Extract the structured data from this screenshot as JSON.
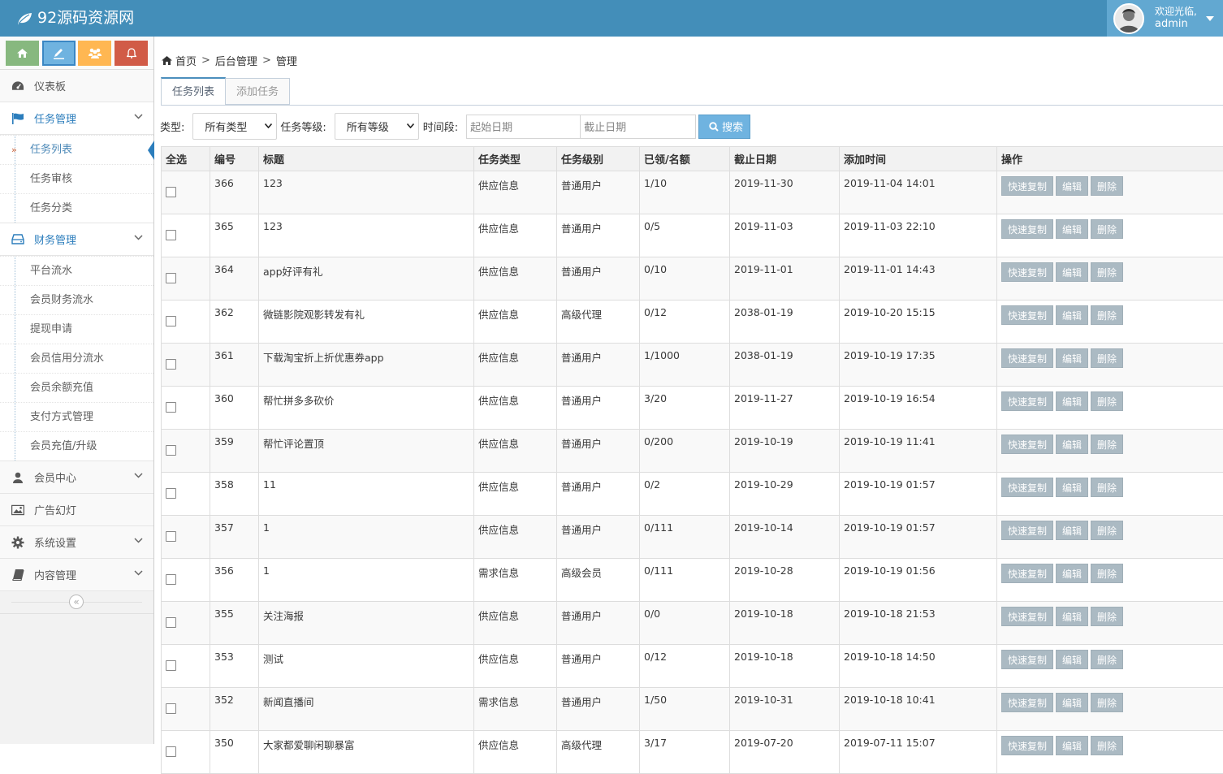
{
  "app": {
    "brand": "92源码资源网",
    "brand_icon": "leaf-icon"
  },
  "user": {
    "welcome": "欢迎光临,",
    "name": "admin"
  },
  "shortcuts": [
    {
      "name": "home-icon",
      "color": "#87b87f"
    },
    {
      "name": "pencil-icon",
      "color": "#6fb3e0"
    },
    {
      "name": "users-icon",
      "color": "#ffb752"
    },
    {
      "name": "bell-icon",
      "color": "#d15b47"
    }
  ],
  "sidebar": {
    "dashboard": "仪表板",
    "task_mgmt": "任务管理",
    "task_sub": [
      "任务列表",
      "任务审核",
      "任务分类"
    ],
    "finance_mgmt": "财务管理",
    "finance_sub": [
      "平台流水",
      "会员财务流水",
      "提现申请",
      "会员信用分流水",
      "会员余额充值",
      "支付方式管理",
      "会员充值/升级"
    ],
    "member_center": "会员中心",
    "ads": "广告幻灯",
    "settings": "系统设置",
    "content": "内容管理",
    "collapse_glyph": "«"
  },
  "breadcrumb": {
    "home": "首页",
    "sep": ">",
    "level2": "后台管理",
    "level3": "管理"
  },
  "tabs": {
    "list": "任务列表",
    "add": "添加任务"
  },
  "filter": {
    "type_label": "类型:",
    "type_value": "所有类型",
    "level_label": "任务等级:",
    "level_value": "所有等级",
    "time_label": "时间段:",
    "start_placeholder": "起始日期",
    "end_placeholder": "截止日期",
    "search_label": "搜索"
  },
  "table": {
    "headers": [
      "全选",
      "编号",
      "标题",
      "任务类型",
      "任务级别",
      "已领/名额",
      "截止日期",
      "添加时间",
      "操作"
    ],
    "actions": {
      "copy": "快速复制",
      "edit": "编辑",
      "delete": "删除"
    },
    "rows": [
      {
        "id": "366",
        "title": "123",
        "type": "供应信息",
        "level": "普通用户",
        "quota": "1/10",
        "deadline": "2019-11-30",
        "added": "2019-11-04 14:01"
      },
      {
        "id": "365",
        "title": "123",
        "type": "供应信息",
        "level": "普通用户",
        "quota": "0/5",
        "deadline": "2019-11-03",
        "added": "2019-11-03 22:10"
      },
      {
        "id": "364",
        "title": "app好评有礼",
        "type": "供应信息",
        "level": "普通用户",
        "quota": "0/10",
        "deadline": "2019-11-01",
        "added": "2019-11-01 14:43"
      },
      {
        "id": "362",
        "title": "微链影院观影转发有礼",
        "type": "供应信息",
        "level": "高级代理",
        "quota": "0/12",
        "deadline": "2038-01-19",
        "added": "2019-10-20 15:15"
      },
      {
        "id": "361",
        "title": "下载淘宝折上折优惠券app",
        "type": "供应信息",
        "level": "普通用户",
        "quota": "1/1000",
        "deadline": "2038-01-19",
        "added": "2019-10-19 17:35"
      },
      {
        "id": "360",
        "title": "帮忙拼多多砍价",
        "type": "供应信息",
        "level": "普通用户",
        "quota": "3/20",
        "deadline": "2019-11-27",
        "added": "2019-10-19 16:54"
      },
      {
        "id": "359",
        "title": "帮忙评论置顶",
        "type": "供应信息",
        "level": "普通用户",
        "quota": "0/200",
        "deadline": "2019-10-19",
        "added": "2019-10-19 11:41"
      },
      {
        "id": "358",
        "title": "11",
        "type": "供应信息",
        "level": "普通用户",
        "quota": "0/2",
        "deadline": "2019-10-29",
        "added": "2019-10-19 01:57"
      },
      {
        "id": "357",
        "title": "1",
        "type": "供应信息",
        "level": "普通用户",
        "quota": "0/111",
        "deadline": "2019-10-14",
        "added": "2019-10-19 01:57"
      },
      {
        "id": "356",
        "title": "1",
        "type": "需求信息",
        "level": "高级会员",
        "quota": "0/111",
        "deadline": "2019-10-28",
        "added": "2019-10-19 01:56"
      },
      {
        "id": "355",
        "title": "关注海报",
        "type": "供应信息",
        "level": "普通用户",
        "quota": "0/0",
        "deadline": "2019-10-18",
        "added": "2019-10-18 21:53"
      },
      {
        "id": "353",
        "title": "测试",
        "type": "供应信息",
        "level": "普通用户",
        "quota": "0/12",
        "deadline": "2019-10-18",
        "added": "2019-10-18 14:50"
      },
      {
        "id": "352",
        "title": "新闻直播间",
        "type": "需求信息",
        "level": "普通用户",
        "quota": "1/50",
        "deadline": "2019-10-31",
        "added": "2019-10-18 10:41"
      },
      {
        "id": "350",
        "title": "大家都爱聊闲聊暴富",
        "type": "供应信息",
        "level": "高级代理",
        "quota": "3/17",
        "deadline": "2019-07-20",
        "added": "2019-07-11 15:07"
      }
    ]
  }
}
